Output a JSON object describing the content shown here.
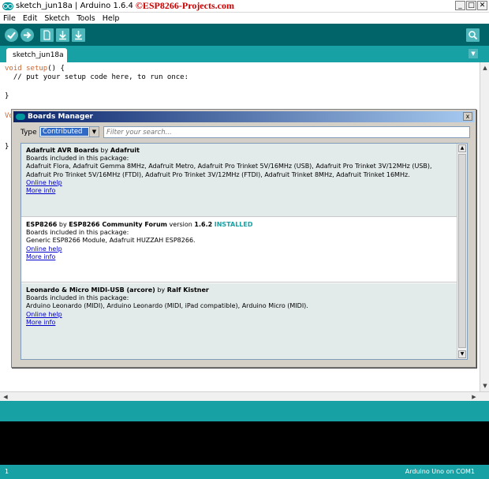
{
  "window": {
    "title": "sketch_jun18a | Arduino 1.6.4",
    "watermark": "©ESP8266-Projects.com",
    "minimize": "_",
    "maximize": "□",
    "close": "✕"
  },
  "menu": [
    "File",
    "Edit",
    "Sketch",
    "Tools",
    "Help"
  ],
  "toolbar": {
    "buttons": [
      "verify-icon",
      "upload-icon",
      "new-icon",
      "open-icon",
      "save-icon"
    ],
    "serial_monitor": "serial-monitor-icon"
  },
  "tab": {
    "name": "sketch_jun18a",
    "menu_glyph": "▼"
  },
  "editor": {
    "line1_kw": "void",
    "line1_fn": "setup",
    "line1_rest": "() {",
    "line2": "  // put your setup code here, to run once:",
    "line4": "}",
    "line6_left": "Vo",
    "line9": "}"
  },
  "dialog": {
    "title": "Boards Manager",
    "close": "x",
    "type_label": "Type",
    "type_value": "Contributed",
    "search_placeholder": "Filter your search...",
    "entries": [
      {
        "name": "Adafruit AVR Boards",
        "by": " by ",
        "author": "Adafruit",
        "version_prefix": "",
        "version": "",
        "installed": "",
        "included_label": "Boards included in this package:",
        "boards_line1": "Adafruit Flora, Adafruit Gemma 8MHz, Adafruit Metro, Adafruit Pro Trinket 5V/16MHz (USB), Adafruit Pro Trinket 3V/12MHz (USB),",
        "boards_line2": "Adafruit Pro Trinket 5V/16MHz (FTDI), Adafruit Pro Trinket 3V/12MHz (FTDI), Adafruit Trinket 8MHz, Adafruit Trinket 16MHz.",
        "online_help": "Online help",
        "more_info": "More info"
      },
      {
        "name": "ESP8266",
        "by": " by ",
        "author": "ESP8266 Community Forum",
        "version_prefix": " version ",
        "version": "1.6.2",
        "installed": "INSTALLED",
        "included_label": "Boards included in this package:",
        "boards_line1": "Generic ESP8266 Module, Adafruit HUZZAH ESP8266.",
        "boards_line2": "",
        "online_help": "Online help",
        "more_info": "More info"
      },
      {
        "name": "Leonardo & Micro MIDI-USB (arcore)",
        "by": " by ",
        "author": "Ralf Kistner",
        "version_prefix": "",
        "version": "",
        "installed": "",
        "included_label": "Boards included in this package:",
        "boards_line1": "Arduino Leonardo (MIDI), Arduino Leonardo (MIDI, iPad compatible), Arduino Micro (MIDI).",
        "boards_line2": "",
        "online_help": "Online help",
        "more_info": "More info"
      }
    ]
  },
  "footer": {
    "line_number": "1",
    "board": "Arduino Uno on COM1"
  },
  "colors": {
    "toolbar": "#006468",
    "tabs_bar": "#17a1a5",
    "button": "#4db7bb",
    "installed": "#17a1a5",
    "console": "#000000"
  }
}
